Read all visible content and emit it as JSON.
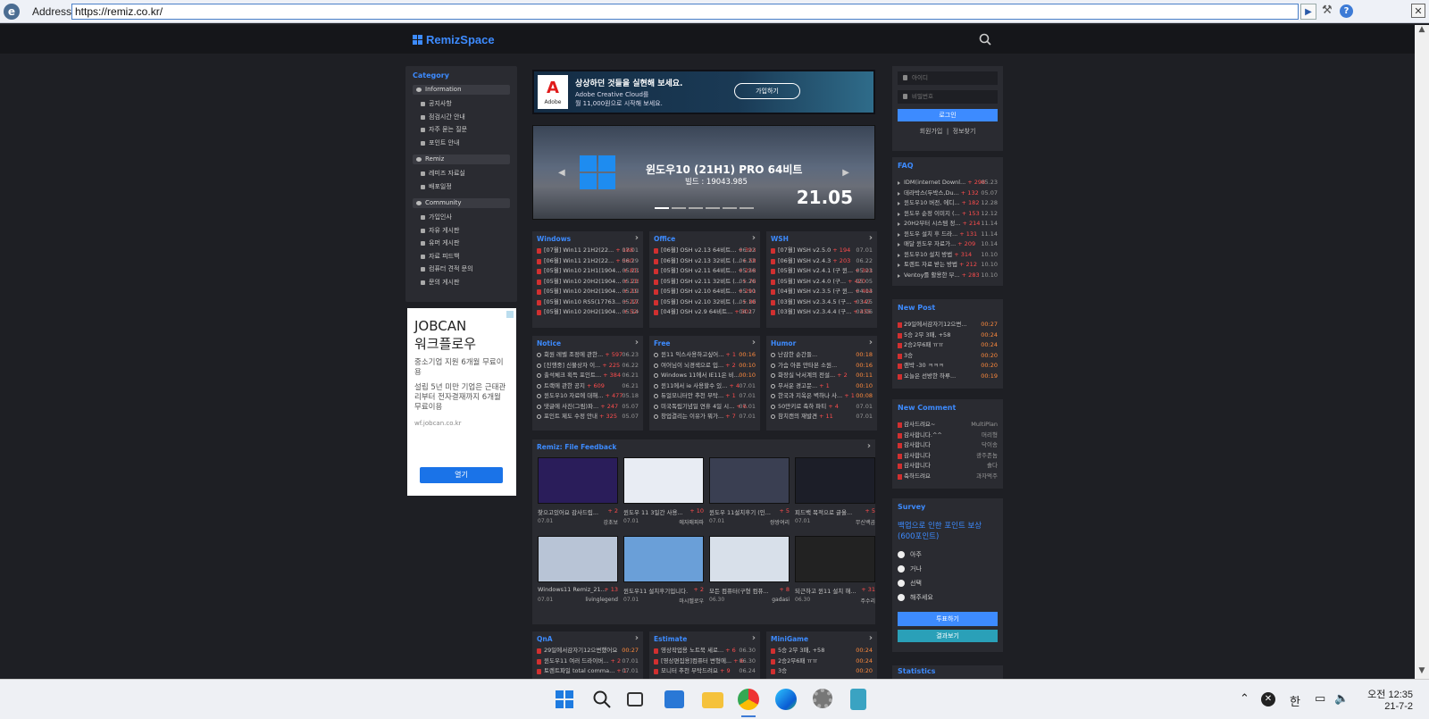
{
  "browser": {
    "address_label": "Address:",
    "url": "https://remiz.co.kr/"
  },
  "site": {
    "logo": "RemizSpace"
  },
  "category": {
    "title": "Category",
    "sections": [
      {
        "label": "Information",
        "items": [
          "공지사항",
          "점검시간 안내",
          "자주 묻는 질문",
          "포인트 안내"
        ]
      },
      {
        "label": "Remiz",
        "items": [
          "레미즈 자료실",
          "배포일정"
        ]
      },
      {
        "label": "Community",
        "items": [
          "가입인사",
          "자유 게시판",
          "유머 게시판",
          "자료 피드백",
          "컴퓨터 견적 문의",
          "문의 게시판"
        ]
      }
    ]
  },
  "ad": {
    "h1": "JOBCAN\n워크플로우",
    "t1": "중소기업 지원 6개월 무료이용",
    "t2": "설립 5년 미만 기업은 근태관리부터 전자결재까지 6개월 무료이용",
    "url": "wf.jobcan.co.kr",
    "btn": "열기"
  },
  "banner": {
    "t1": "상상하던 것들을 실현해 보세요.",
    "t2a": "Adobe Creative Cloud를",
    "t2b": "월 11,000원으로 시작해 보세요.",
    "btn": "가입하기",
    "brand": "Adobe"
  },
  "slider": {
    "title": "윈도우10 (21H1) PRO 64비트",
    "build": "빌드 : 19043.985",
    "version": "21.05"
  },
  "boards_top": [
    {
      "title": "Windows",
      "rows": [
        [
          "[07월] Win11 21H2(22...",
          "+ 188",
          "07.01"
        ],
        [
          "[06월] Win11 21H2(22...",
          "+ 580",
          "06.29"
        ],
        [
          "[05월] Win10 21H1(1904...",
          "+ 812",
          "05.23"
        ],
        [
          "[05월] Win10 20H2(1904...",
          "+ 119",
          "05.21"
        ],
        [
          "[05월] Win10 20H2(1904...",
          "+ 211",
          "05.19"
        ],
        [
          "[05월] Win10 RS5(17763...",
          "+ 220",
          "05.17"
        ],
        [
          "[05월] Win10 20H2(1904...",
          "+ 524",
          "05.14"
        ]
      ]
    },
    {
      "title": "Office",
      "rows": [
        [
          "[06월] OSH v2.13 64비트...",
          "+ 393",
          "06.22"
        ],
        [
          "[06월] OSH v2.13 32비트 (...",
          "+ 59",
          "06.22"
        ],
        [
          "[05월] OSH v2.11 64비트...",
          "+ 258",
          "05.26"
        ],
        [
          "[05월] OSH v2.11 32비트 (...",
          "+ 70",
          "05.26"
        ],
        [
          "[05월] OSH v2.10 64비트...",
          "+ 291",
          "05.10"
        ],
        [
          "[05월] OSH v2.10 32비트 (...",
          "+ 86",
          "05.10"
        ],
        [
          "[04월] OSH v2.9 64비트...",
          "+ 301",
          "04.27"
        ]
      ]
    },
    {
      "title": "WSH",
      "rows": [
        [
          "[07월] WSH v2.5.0",
          "+ 194",
          "07.01"
        ],
        [
          "[06월] WSH v2.4.3",
          "+ 203",
          "06.22"
        ],
        [
          "[05월] WSH v2.4.1 (구 윈...",
          "+ 301",
          "05.23"
        ],
        [
          "[05월] WSH v2.4.0 (구...",
          "+ 420",
          "05.05"
        ],
        [
          "[04월] WSH v2.3.5 (구 윈...",
          "+ 404",
          "04.13"
        ],
        [
          "[03월] WSH v2.3.4.5 (구...",
          "+ 347",
          "03.25"
        ],
        [
          "[03월] WSH v2.3.4.4 (구...",
          "+ 455",
          "03.06"
        ]
      ]
    }
  ],
  "boards_mid": [
    {
      "title": "Notice",
      "rows": [
        [
          "회원 레벨 조정에 관한...",
          "+ 597",
          "06.23"
        ],
        [
          "[진행중] 신불상자 이...",
          "+ 225",
          "06.22"
        ],
        [
          "출석체크 획득 포인트...",
          "+ 384",
          "06.21"
        ],
        [
          "트랙에 관한 공지",
          "+ 609",
          "06.21"
        ],
        [
          "윈도우10 자료에 대해...",
          "+ 477",
          "05.18"
        ],
        [
          "댓글에 사진(그림)파...",
          "+ 247",
          "05.07"
        ],
        [
          "포인트 제도 수정 안내",
          "+ 325",
          "05.07"
        ]
      ]
    },
    {
      "title": "Free",
      "rows": [
        [
          "윈11 익스사용하고싶어...",
          "+ 1",
          "00:16"
        ],
        [
          "여어님이 뇌경색으로 입...",
          "+ 2",
          "00:10"
        ],
        [
          "Windows 11에서 IE11은 비...",
          "",
          "00:10"
        ],
        [
          "윈11에서 ie 사용할수 있...",
          "+ 4",
          "07.01"
        ],
        [
          "듀얼모니터안 추천 부탁...",
          "+ 1",
          "07.01"
        ],
        [
          "미국독립기념일 연휴 4일 시...",
          "+ 6",
          "07.01"
        ],
        [
          "창업결리는 이유가 뭐가...",
          "+ 7",
          "07.01"
        ]
      ]
    },
    {
      "title": "Humor",
      "rows": [
        [
          "난감한 순간들...",
          "",
          "00:18"
        ],
        [
          "가슴 아픈 만타본 소원...",
          "",
          "00:16"
        ],
        [
          "화장실 낙서계의 전설...",
          "+ 2",
          "00:11"
        ],
        [
          "무서운 경고문...",
          "+ 1",
          "00:10"
        ],
        [
          "한국과 지옥은 벽하나 사...",
          "+ 1",
          "00:08"
        ],
        [
          "50만키로 축하 파티",
          "+ 4",
          "07.01"
        ],
        [
          "참치캔의 재발견",
          "+ 11",
          "07.01"
        ]
      ]
    }
  ],
  "feedback": {
    "title": "Remiz: File Feedback",
    "items": [
      {
        "cap": "찾으고있어요 감사드립...",
        "cnt": "+ 2",
        "date": "07.01",
        "user": "강초보"
      },
      {
        "cap": "윈도우 11 3일간 사용...",
        "cnt": "+ 10",
        "date": "07.01",
        "user": "에자매파파"
      },
      {
        "cap": "윈도우 11설치후기 (인...",
        "cnt": "+ 5",
        "date": "07.01",
        "user": "쌍쌍여리"
      },
      {
        "cap": "피드백 목적으로 글올...",
        "cnt": "+ 5",
        "date": "07.01",
        "user": "무신백곰"
      },
      {
        "cap": "Windows11 Remiz_21...",
        "cnt": "+ 13",
        "date": "07.01",
        "user": "livinglegend"
      },
      {
        "cap": "윈도우11 설치후기입니다.",
        "cnt": "+ 2",
        "date": "07.01",
        "user": "마시멜로우"
      },
      {
        "cap": "모든 컴퓨터(구형 컴퓨...",
        "cnt": "+ 8",
        "date": "06.30",
        "user": "gadasi"
      },
      {
        "cap": "되근하고 윈11 설치 해...",
        "cnt": "+ 31",
        "date": "06.30",
        "user": "주수리"
      }
    ]
  },
  "boards_bot": [
    {
      "title": "QnA",
      "rows": [
        [
          "29일에서감자기12으변했어요",
          "",
          "00:27"
        ],
        [
          "윈도우11 여러 드라이버...",
          "+ 2",
          "07.01"
        ],
        [
          "토렌트파일 total comma...",
          "+ 1",
          "07.01"
        ]
      ]
    },
    {
      "title": "Estimate",
      "rows": [
        [
          "영상작업용 노트북 세로...",
          "+ 6",
          "06.30"
        ],
        [
          "[영상편집용]컴퓨터 변형에...",
          "+ 6",
          "06.30"
        ],
        [
          "모니터 추천 부탁드려요",
          "+ 9",
          "06.24"
        ]
      ]
    },
    {
      "title": "MiniGame",
      "rows": [
        [
          "5승 2무 3패, +58",
          "",
          "00:24"
        ],
        [
          "2승2무6패 ㅠㅠ",
          "",
          "00:24"
        ],
        [
          "3승",
          "",
          "00:20"
        ]
      ]
    }
  ],
  "login": {
    "id": "아이디",
    "pw": "비밀번호",
    "btn": "로그인",
    "links": "회원가입  |  정보찾기"
  },
  "faq": {
    "title": "FAQ",
    "rows": [
      [
        "IDM(internet Downl...",
        "+ 298",
        "05.23"
      ],
      [
        "데라박스(두박스,Du...",
        "+ 132",
        "05.07"
      ],
      [
        "윈도우10 버전, 에디...",
        "+ 182",
        "12.28"
      ],
      [
        "윈도우 순정 이미지 (...",
        "+ 153",
        "12.12"
      ],
      [
        "20H2부터 시스템 정...",
        "+ 214",
        "11.14"
      ],
      [
        "윈도우 설치 후 드라...",
        "+ 131",
        "11.14"
      ],
      [
        "매달 윈도우 자료가...",
        "+ 209",
        "10.14"
      ],
      [
        "윈도우10 설치 방법",
        "+ 314",
        "10.10"
      ],
      [
        "토렌트 자료 받는 방법",
        "+ 212",
        "10.10"
      ],
      [
        "Ventoy를 활용한 부...",
        "+ 283",
        "10.10"
      ]
    ]
  },
  "newpost": {
    "title": "New Post",
    "rows": [
      [
        "29일에서감자기12으변...",
        "00:27"
      ],
      [
        "5승 2무 3패, +58",
        "00:24"
      ],
      [
        "2승2무6패 ㅠㅠ",
        "00:24"
      ],
      [
        "3승",
        "00:20"
      ],
      [
        "랜박 -30 ㅋㅋㅋ",
        "00:20"
      ],
      [
        "오늘은 선방한 하루...",
        "00:19"
      ]
    ]
  },
  "newcomment": {
    "title": "New Comment",
    "rows": [
      [
        "감사드려요~",
        "MultiPlan"
      ],
      [
        "감사합니다.^^",
        "머리형"
      ],
      [
        "감사합니다",
        "닥이송"
      ],
      [
        "감사합니다",
        "광주존놈"
      ],
      [
        "감사합니다",
        "솔다"
      ],
      [
        "축하드려요",
        "과자먹주"
      ]
    ]
  },
  "survey": {
    "title": "Survey",
    "question": "백업으로 인한 포인트 보상 (600포인트)",
    "options": [
      "아주",
      "거나",
      "선택",
      "해주세요"
    ],
    "vote": "투표하기",
    "result": "결과보기"
  },
  "statistics": {
    "title": "Statistics"
  },
  "clock": {
    "time": "오전 12:35",
    "date": "21-7-2"
  },
  "tray": {
    "ime": "한"
  }
}
